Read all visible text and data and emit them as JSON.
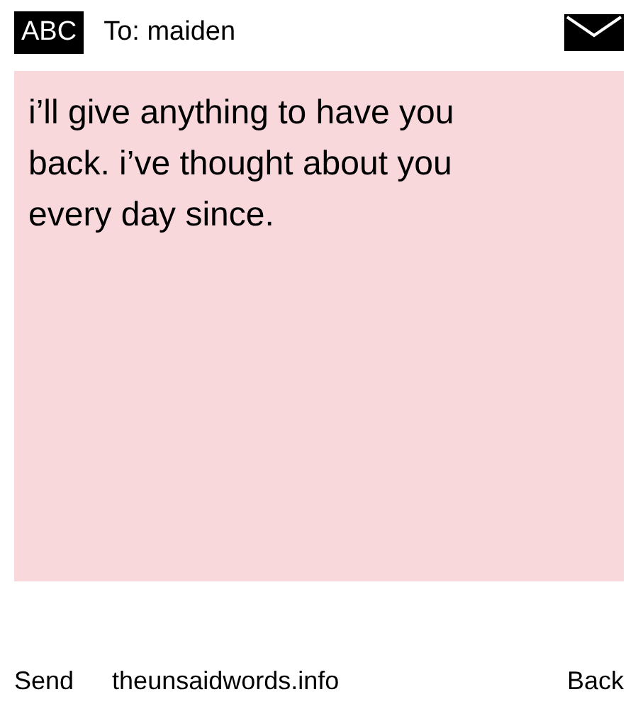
{
  "header": {
    "mode": "ABC",
    "recipient": "To: maiden"
  },
  "message": {
    "text": "i’ll give anything to have you back. i’ve thought about you every day since."
  },
  "footer": {
    "left": "Send",
    "site": "theunsaidwords.info",
    "right": "Back"
  }
}
